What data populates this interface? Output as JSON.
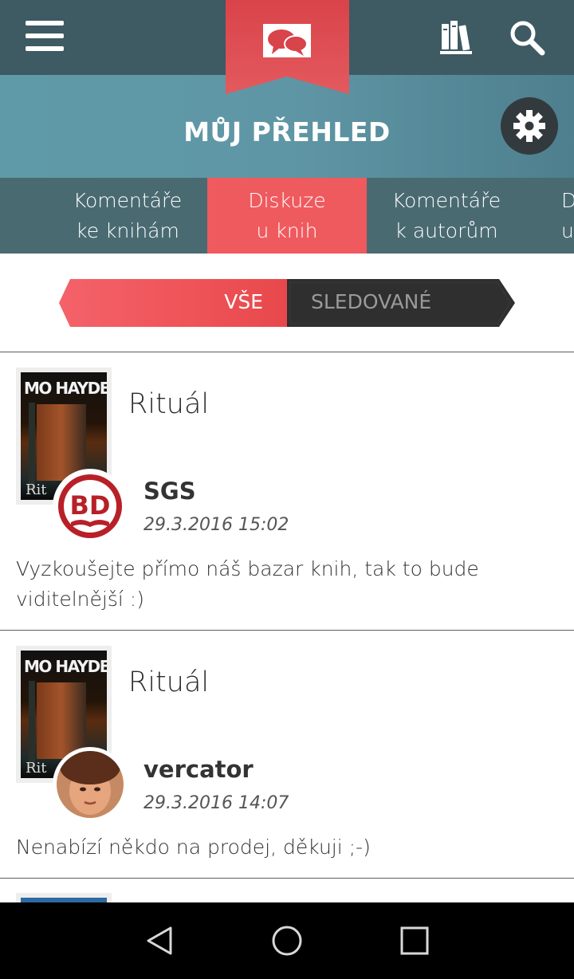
{
  "topbar": {
    "menu_icon": "hamburger-menu-icon",
    "logo_icon": "book-chat-bubbles-logo",
    "library_icon": "books-icon",
    "search_icon": "search-icon",
    "background_color": "#3e5a63",
    "logo_color": "#e0474c"
  },
  "header": {
    "title": "MŮJ PŘEHLED",
    "settings_icon": "gear-icon"
  },
  "tabs": [
    {
      "line1": "Komentáře",
      "line2": "ke knihám",
      "active": false
    },
    {
      "line1": "Diskuze",
      "line2": "u knih",
      "active": true
    },
    {
      "line1": "Komentáře",
      "line2": "k autorům",
      "active": false
    },
    {
      "line1": "D",
      "line2": "u",
      "active": false
    }
  ],
  "segment": {
    "all_label": "VŠE",
    "followed_label": "SLEDOVANÉ",
    "selected": "VŠE",
    "accent_color": "#ef5a5e"
  },
  "posts": [
    {
      "cover_author": "MO HAYDER",
      "cover_subtitle": "Rit",
      "book_title": "Rituál",
      "username": "SGS",
      "timestamp": "29.3.2016 15:02",
      "avatar_text": "BD",
      "comment": "Vyzkoušejte přímo náš bazar knih, tak to bude viditelnější :)"
    },
    {
      "cover_author": "MO HAYDER",
      "cover_subtitle": "Rit",
      "book_title": "Rituál",
      "username": "vercator",
      "timestamp": "29.3.2016 14:07",
      "avatar_text": "",
      "comment": "Nenabízí někdo na prodej,  děkuji ;-)"
    }
  ],
  "navbar": {
    "back_icon": "back-triangle-icon",
    "home_icon": "home-circle-icon",
    "recents_icon": "recents-square-icon"
  }
}
